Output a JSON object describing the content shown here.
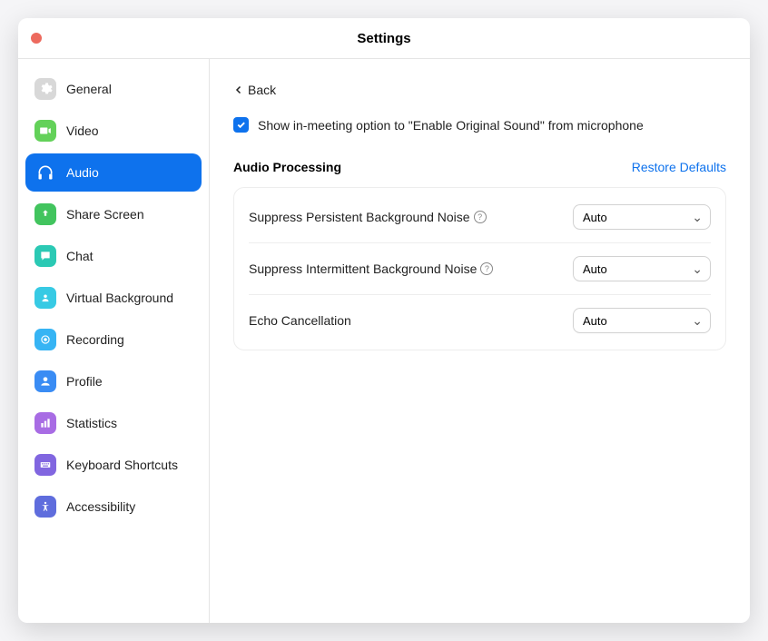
{
  "window": {
    "title": "Settings"
  },
  "sidebar": {
    "activeIndex": 2,
    "items": [
      {
        "label": "General"
      },
      {
        "label": "Video"
      },
      {
        "label": "Audio"
      },
      {
        "label": "Share Screen"
      },
      {
        "label": "Chat"
      },
      {
        "label": "Virtual Background"
      },
      {
        "label": "Recording"
      },
      {
        "label": "Profile"
      },
      {
        "label": "Statistics"
      },
      {
        "label": "Keyboard Shortcuts"
      },
      {
        "label": "Accessibility"
      }
    ]
  },
  "main": {
    "back_label": "Back",
    "checkbox": {
      "checked": true,
      "label": "Show in-meeting option to \"Enable Original Sound\" from microphone"
    },
    "section_title": "Audio Processing",
    "restore_label": "Restore Defaults",
    "rows": [
      {
        "label": "Suppress Persistent Background Noise",
        "has_help": true,
        "value": "Auto"
      },
      {
        "label": "Suppress Intermittent Background Noise",
        "has_help": true,
        "value": "Auto"
      },
      {
        "label": "Echo Cancellation",
        "has_help": false,
        "value": "Auto"
      }
    ]
  },
  "colors": {
    "accent": "#0e72ed"
  }
}
